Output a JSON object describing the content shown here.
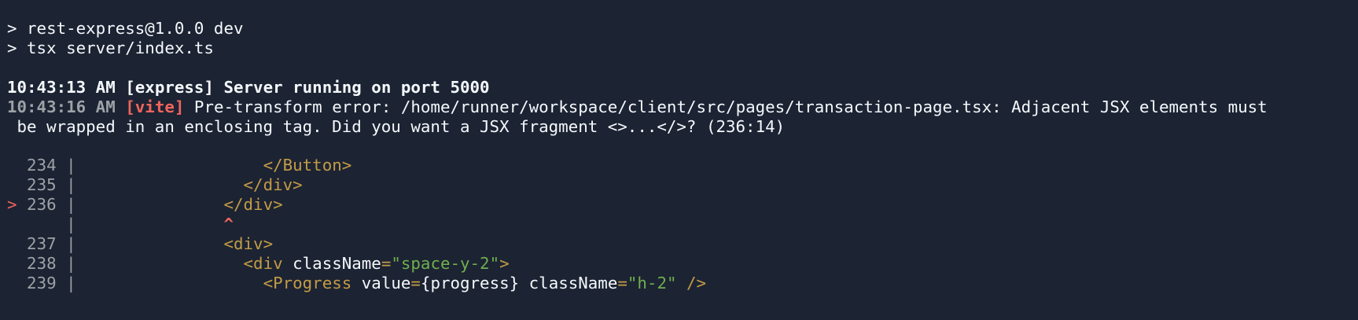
{
  "terminal": {
    "npm_lines": [
      "> rest-express@1.0.0 dev",
      "> tsx server/index.ts"
    ],
    "express_log": {
      "time": "10:43:13 AM",
      "tag": "[express]",
      "message": "Server running on port 5000"
    },
    "vite_log": {
      "time": "10:43:16 AM",
      "tag": "[vite]",
      "message_line1": "Pre-transform error: /home/runner/workspace/client/src/pages/transaction-page.tsx: Adjacent JSX elements must",
      "message_line2": " be wrapped in an enclosing tag. Did you want a JSX fragment <>...</>? (236:14)"
    },
    "code_frame": {
      "pointer": ">",
      "separator": "|",
      "caret": "^",
      "lines": [
        {
          "num": "234",
          "indent": "                   ",
          "tag_open": "</Button>"
        },
        {
          "num": "235",
          "indent": "                 ",
          "tag_open": "</div>"
        },
        {
          "num": "236",
          "indent": "               ",
          "tag_open": "</div>"
        },
        {
          "num": "237",
          "indent": "               ",
          "tag_open": "<div>"
        },
        {
          "num": "238",
          "indent": "                 ",
          "tag_open": "<div",
          "attr": " className",
          "eq": "=",
          "str": "\"space-y-2\"",
          "tag_close": ">"
        },
        {
          "num": "239",
          "indent": "                   ",
          "tag_open": "<Progress",
          "attr": " value",
          "eq": "=",
          "code": "{progress}",
          "attr2": " className",
          "eq2": "=",
          "str": "\"h-2\"",
          "tag_close": " />"
        }
      ],
      "caret_indent": "               "
    }
  }
}
